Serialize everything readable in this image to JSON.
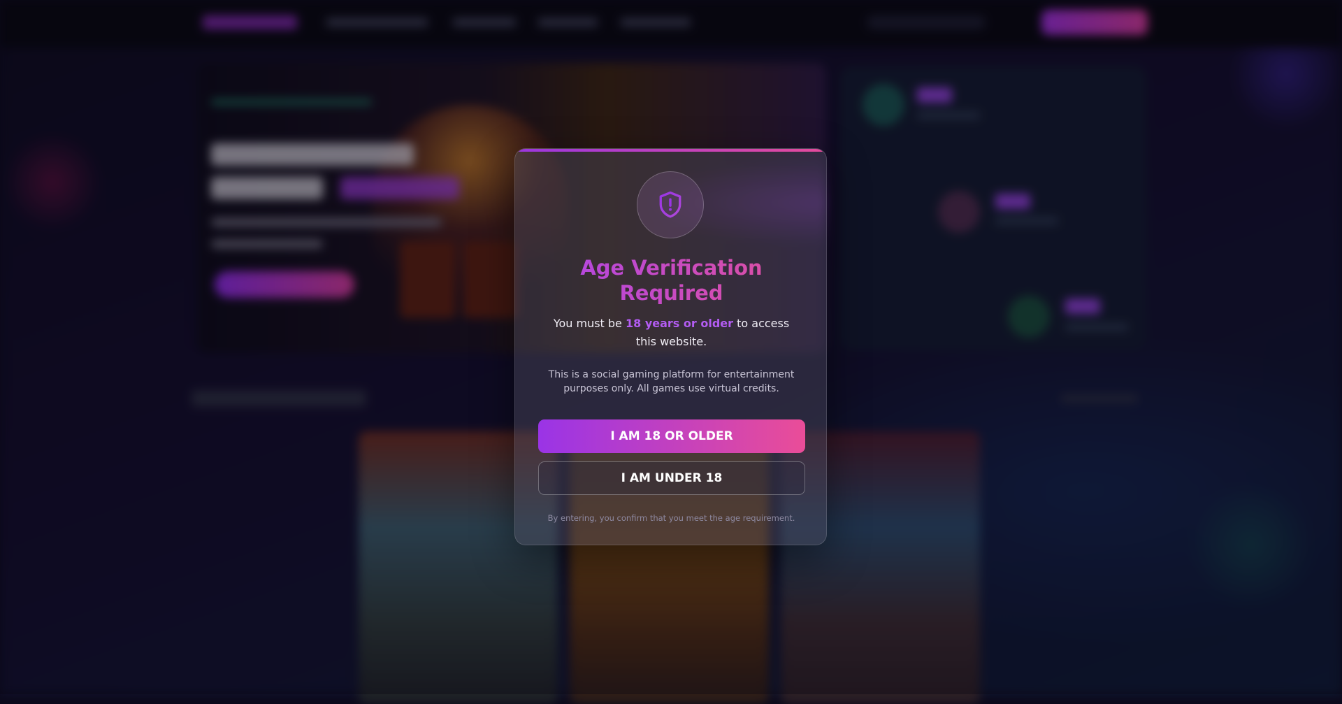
{
  "modal": {
    "title": "Age Verification Required",
    "subtitle": {
      "prefix": "You must be",
      "highlight": "18 years or older",
      "suffix": "to access this website."
    },
    "note": "This is a social gaming platform for entertainment purposes only. All games use virtual credits.",
    "confirm_button": "I AM 18 OR OLDER",
    "deny_button": "I AM UNDER 18",
    "footnote": "By entering, you confirm that you meet the age requirement.",
    "icon": "shield-alert-icon"
  },
  "colors": {
    "accent_purple": "#9a34e6",
    "accent_pink": "#ea4d98",
    "highlight": "#b35cf2"
  }
}
